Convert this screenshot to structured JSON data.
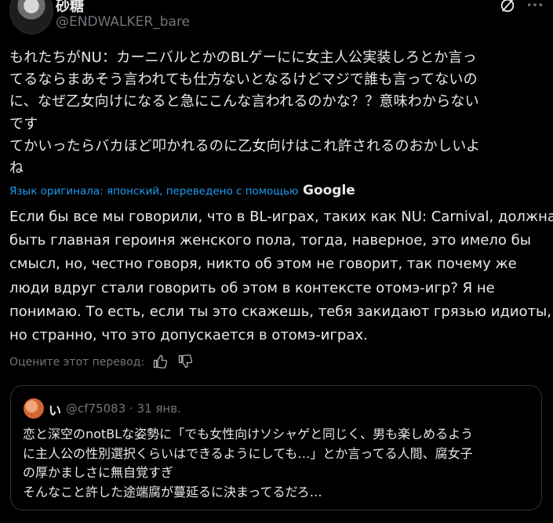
{
  "author": {
    "display_name": "砂糖",
    "handle": "@ENDWALKER_bare"
  },
  "original_text_lines": [
    "もれたちがNU：カーニバルとかのBLゲーにに女主人公実装しろとか言っ",
    "てるならまあそう言われても仕方ないとなるけどマジで誰も言ってないの",
    "に、なぜ乙女向けになると急にこんな言われるのかな？？意味わからない",
    "です",
    "てかいったらバカほど叩かれるのに乙女向けはこれ許されるのおかしいよ",
    "ね"
  ],
  "translation_note": {
    "text": "Язык оригинала: японский, переведено с помощью",
    "provider": "Google"
  },
  "translated_text_lines": [
    "Если бы все мы говорили, что в BL-играх, таких как NU: Carnival, должна",
    "быть главная героиня женского пола, тогда, наверное, это имело бы",
    "смысл, но, честно говоря, никто об этом не говорит, так почему же",
    "люди вдруг стали говорить об этом в контексте отомэ-игр? Я не",
    "понимаю. То есть, если ты это скажешь, тебя закидают грязью идиоты,",
    "но странно, что это допускается в отомэ-играх."
  ],
  "rate_translation_label": "Оцените этот перевод:",
  "quote": {
    "display_name": "い",
    "handle_time": "@cf75083 · 31 янв.",
    "text_lines": [
      "恋と深空のnotBLな姿勢に「でも女性向けソシャゲと同じく、男も楽しめるよう",
      "に主人公の性別選択くらいはできるようにしても…」とか言ってる人間、腐女子",
      "の厚かましさに無自覚すぎ",
      "そんなこと許した途端腐が蔓延るに決まってるだろ…"
    ]
  },
  "icons": {
    "grok": "grok-icon",
    "more": "more-icon",
    "like": "thumb-up-icon",
    "dislike": "thumb-down-icon"
  },
  "colors": {
    "background": "#000000",
    "text": "#e7e9ea",
    "muted": "#71767b",
    "link": "#1d9bf0",
    "border": "#2f3336"
  }
}
